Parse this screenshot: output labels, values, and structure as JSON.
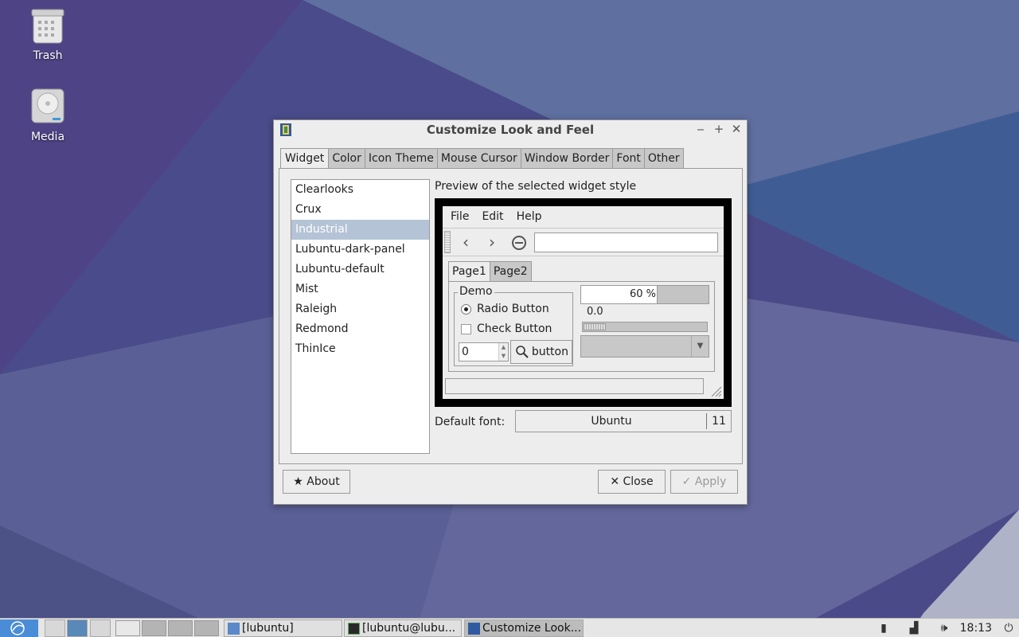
{
  "desktop": {
    "icons": [
      {
        "label": "Trash"
      },
      {
        "label": "Media"
      }
    ]
  },
  "dialog": {
    "title": "Customize Look and Feel",
    "tabs": [
      "Widget",
      "Color",
      "Icon Theme",
      "Mouse Cursor",
      "Window Border",
      "Font",
      "Other"
    ],
    "active_tab": "Widget",
    "themes": [
      "Clearlooks",
      "Crux",
      "Industrial",
      "Lubuntu-dark-panel",
      "Lubuntu-default",
      "Mist",
      "Raleigh",
      "Redmond",
      "ThinIce"
    ],
    "selected_theme": "Industrial",
    "preview_label": "Preview of the selected widget style",
    "preview": {
      "menu": [
        "File",
        "Edit",
        "Help"
      ],
      "tabs": [
        "Page1",
        "Page2"
      ],
      "demo_legend": "Demo",
      "radio_label": "Radio Button",
      "check_label": "Check Button",
      "spin_value": "0",
      "button_label": "button",
      "progress_text": "60 %",
      "progress_fraction": 0.6,
      "scale_value": "0.0"
    },
    "default_font_label": "Default font:",
    "font_name": "Ubuntu",
    "font_size": "11",
    "about_label": "About",
    "close_label": "Close",
    "apply_label": "Apply"
  },
  "taskbar": {
    "tasks": [
      "[lubuntu]",
      "[lubuntu@lubu...",
      "Customize Look..."
    ],
    "clock": "18:13"
  }
}
